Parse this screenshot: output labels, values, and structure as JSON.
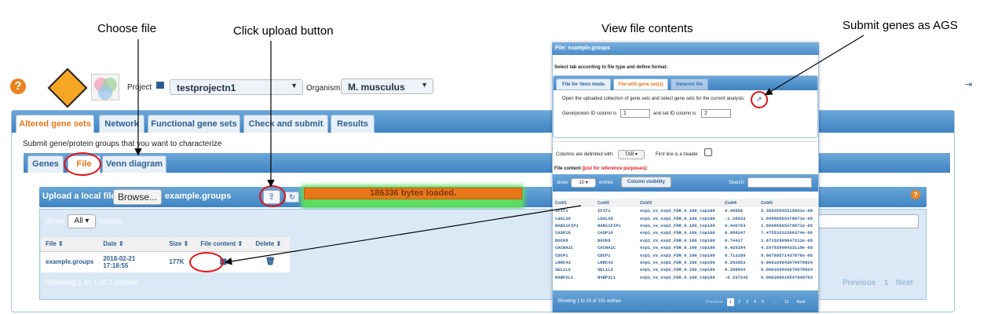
{
  "annotations": {
    "choose_file": "Choose file",
    "click_upload": "Click upload button",
    "view_contents": "View file contents",
    "submit_genes": "Submit genes as AGS"
  },
  "header": {
    "help_glyph": "?",
    "project_label": "Project",
    "project_value": "testprojectn1",
    "organism_label": "Organism",
    "organism_value": "M. musculus"
  },
  "tabs": [
    "Altered gene sets",
    "Network",
    "Functional gene sets",
    "Check and submit",
    "Results"
  ],
  "active_tab": "Altered gene sets",
  "description": "Submit gene/protein groups that you want to characterize",
  "subtabs": [
    "Genes",
    "File",
    "Venn diagram"
  ],
  "active_subtab": "File",
  "upload": {
    "label": "Upload a local file",
    "browse": "Browse...",
    "filename": "example.groups",
    "progress_text": "186336 bytes loaded.",
    "progress": 1.0
  },
  "list": {
    "show": "Show",
    "show_value": "All",
    "entries": "entries",
    "headers": [
      "File",
      "Date",
      "Size",
      "File content",
      "Delete"
    ],
    "rows": [
      {
        "file": "example.groups",
        "date": "2018-02-21 17:18:55",
        "size": "177K"
      }
    ],
    "footer": "Showing 1 to 1 of 1 entries",
    "pager": {
      "prev": "Previous",
      "page": "1",
      "next": "Next"
    }
  },
  "popup": {
    "title": "File: example.groups",
    "instruction": "Select tab according to file type and define format:",
    "tabs": [
      "File for Venn mode",
      "File with gene set(s)",
      "Network file"
    ],
    "active_tab": "File with gene set(s)",
    "open_text": "Open the uploaded collection of gene sets and select gene sets for the current analysis:",
    "gene_col_label": "Gene/protein ID column is",
    "gene_col_value": "1",
    "set_col_label": "and set ID column is",
    "set_col_value": "2",
    "delim_label": "Columns are delimited with",
    "delim_value": "TAB",
    "header_label": "First line is a header",
    "content_label": "File content",
    "content_note": "(just for reference purposes)",
    "content_colon": ":",
    "show": "show",
    "show_value": "10",
    "entries": "entries",
    "colvis": "Column visibility",
    "search": "Search:",
    "columns": [
      "Col#1",
      "Col#2",
      "Col#3",
      "Col#4",
      "Col#5"
    ],
    "rows": [
      [
        "IFIT1",
        "IFIT1",
        "exp1_vs_exp2_FDR_0.100_top100",
        "0.40566",
        "5.39935545315601e-08"
      ],
      [
        "LGALS9",
        "LGALS9",
        "exp1_vs_exp2_FDR_0.100_top100",
        "-1.26633",
        "1.66686565470871e-05"
      ],
      [
        "RAB11FIP1",
        "RAB11FIP1",
        "exp1_vs_exp2_FDR_0.100_top100",
        "0.440763",
        "1.66686565470871e-05"
      ],
      [
        "CASP16",
        "CASP16",
        "exp1_vs_exp2_FDR_0.100_top100",
        "0.688247",
        "7.47553232396374e-06"
      ],
      [
        "DOCK8",
        "DOCK8",
        "exp1_vs_exp2_FDR_0.100_top100",
        "0.74417",
        "1.67152909647213e-05"
      ],
      [
        "CACNA1C",
        "CACNA1C",
        "exp1_vs_exp2_FDR_0.100_top100",
        "0.429184",
        "4.29793998433119e-05"
      ],
      [
        "CDCP1",
        "CDCP1",
        "exp1_vs_exp2_FDR_0.100_top100",
        "0.713189",
        "9.80789571437876e-05"
      ],
      [
        "LRRC43",
        "LRRC43",
        "exp1_vs_exp2_FDR_0.100_top100",
        "0.292053",
        "0.000109943670678824"
      ],
      [
        "SEL1L2",
        "SEL1L2",
        "exp1_vs_exp2_FDR_0.100_top100",
        "0.398644",
        "0.000109943670678824"
      ],
      [
        "N4BP2L1",
        "N4BP2L1",
        "exp1_vs_exp2_FDR_0.100_top100",
        "-0.237242",
        "0.000186610547848703"
      ]
    ],
    "footer": "Showing 1 to 10 of 101 entries",
    "pages": [
      "Previous",
      "1",
      "2",
      "3",
      "4",
      "5",
      "...",
      "11",
      "Next"
    ]
  },
  "colors": {
    "accent": "#e8771a",
    "tab_blue": "#3f84c4",
    "annotation_red": "#e0141a",
    "progress_orange": "#e8771a",
    "progress_green": "#3dcc3d"
  }
}
